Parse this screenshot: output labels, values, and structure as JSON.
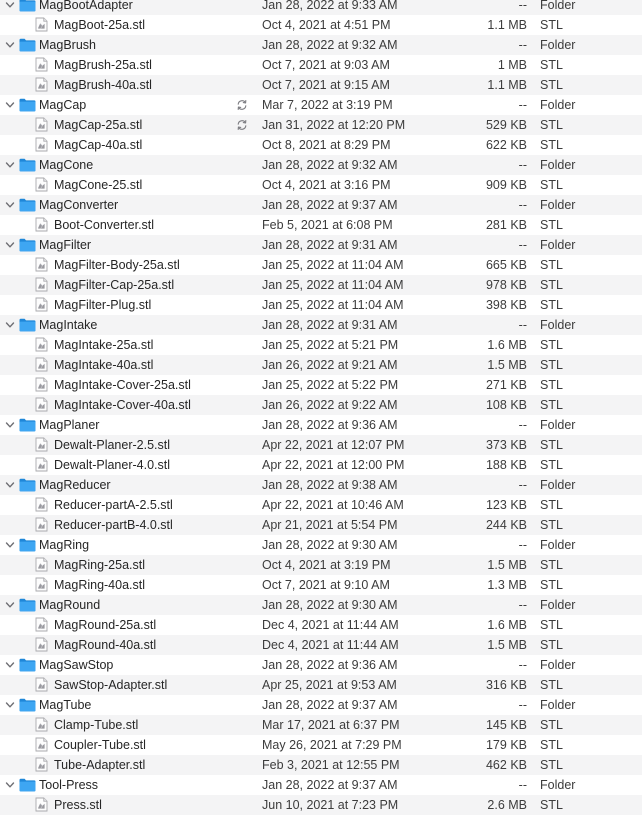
{
  "colors": {
    "folder_blue": "#3ea6f2",
    "folder_blue_dark": "#1f87d8",
    "stripe": "#f4f4f5",
    "text": "#262626",
    "secondary_text": "#3c3c3c"
  },
  "icons": {
    "disclosure": "chevron-down-icon",
    "folder": "folder-icon",
    "file": "stl-file-icon",
    "sync": "sync-icon"
  },
  "rows": [
    {
      "type": "folder",
      "name": "MagBootAdapter",
      "date": "Jan 28, 2022 at 9:33 AM",
      "size": "--",
      "kind": "Folder"
    },
    {
      "type": "file",
      "name": "MagBoot-25a.stl",
      "date": "Oct 4, 2021 at 4:51 PM",
      "size": "1.1 MB",
      "kind": "STL"
    },
    {
      "type": "folder",
      "name": "MagBrush",
      "date": "Jan 28, 2022 at 9:32 AM",
      "size": "--",
      "kind": "Folder"
    },
    {
      "type": "file",
      "name": "MagBrush-25a.stl",
      "date": "Oct 7, 2021 at 9:03 AM",
      "size": "1 MB",
      "kind": "STL"
    },
    {
      "type": "file",
      "name": "MagBrush-40a.stl",
      "date": "Oct 7, 2021 at 9:15 AM",
      "size": "1.1 MB",
      "kind": "STL"
    },
    {
      "type": "folder",
      "name": "MagCap",
      "date": "Mar 7, 2022 at 3:19 PM",
      "size": "--",
      "kind": "Folder",
      "sync": true
    },
    {
      "type": "file",
      "name": "MagCap-25a.stl",
      "date": "Jan 31, 2022 at 12:20 PM",
      "size": "529 KB",
      "kind": "STL",
      "sync": true
    },
    {
      "type": "file",
      "name": "MagCap-40a.stl",
      "date": "Oct 8, 2021 at 8:29 PM",
      "size": "622 KB",
      "kind": "STL"
    },
    {
      "type": "folder",
      "name": "MagCone",
      "date": "Jan 28, 2022 at 9:32 AM",
      "size": "--",
      "kind": "Folder"
    },
    {
      "type": "file",
      "name": "MagCone-25.stl",
      "date": "Oct 4, 2021 at 3:16 PM",
      "size": "909 KB",
      "kind": "STL"
    },
    {
      "type": "folder",
      "name": "MagConverter",
      "date": "Jan 28, 2022 at 9:37 AM",
      "size": "--",
      "kind": "Folder"
    },
    {
      "type": "file",
      "name": "Boot-Converter.stl",
      "date": "Feb 5, 2021 at 6:08 PM",
      "size": "281 KB",
      "kind": "STL"
    },
    {
      "type": "folder",
      "name": "MagFilter",
      "date": "Jan 28, 2022 at 9:31 AM",
      "size": "--",
      "kind": "Folder"
    },
    {
      "type": "file",
      "name": "MagFilter-Body-25a.stl",
      "date": "Jan 25, 2022 at 11:04 AM",
      "size": "665 KB",
      "kind": "STL"
    },
    {
      "type": "file",
      "name": "MagFilter-Cap-25a.stl",
      "date": "Jan 25, 2022 at 11:04 AM",
      "size": "978 KB",
      "kind": "STL"
    },
    {
      "type": "file",
      "name": "MagFilter-Plug.stl",
      "date": "Jan 25, 2022 at 11:04 AM",
      "size": "398 KB",
      "kind": "STL"
    },
    {
      "type": "folder",
      "name": "MagIntake",
      "date": "Jan 28, 2022 at 9:31 AM",
      "size": "--",
      "kind": "Folder"
    },
    {
      "type": "file",
      "name": "MagIntake-25a.stl",
      "date": "Jan 25, 2022 at 5:21 PM",
      "size": "1.6 MB",
      "kind": "STL"
    },
    {
      "type": "file",
      "name": "MagIntake-40a.stl",
      "date": "Jan 26, 2022 at 9:21 AM",
      "size": "1.5 MB",
      "kind": "STL"
    },
    {
      "type": "file",
      "name": "MagIntake-Cover-25a.stl",
      "date": "Jan 25, 2022 at 5:22 PM",
      "size": "271 KB",
      "kind": "STL"
    },
    {
      "type": "file",
      "name": "MagIntake-Cover-40a.stl",
      "date": "Jan 26, 2022 at 9:22 AM",
      "size": "108 KB",
      "kind": "STL"
    },
    {
      "type": "folder",
      "name": "MagPlaner",
      "date": "Jan 28, 2022 at 9:36 AM",
      "size": "--",
      "kind": "Folder"
    },
    {
      "type": "file",
      "name": "Dewalt-Planer-2.5.stl",
      "date": "Apr 22, 2021 at 12:07 PM",
      "size": "373 KB",
      "kind": "STL"
    },
    {
      "type": "file",
      "name": "Dewalt-Planer-4.0.stl",
      "date": "Apr 22, 2021 at 12:00 PM",
      "size": "188 KB",
      "kind": "STL"
    },
    {
      "type": "folder",
      "name": "MagReducer",
      "date": "Jan 28, 2022 at 9:38 AM",
      "size": "--",
      "kind": "Folder"
    },
    {
      "type": "file",
      "name": "Reducer-partA-2.5.stl",
      "date": "Apr 22, 2021 at 10:46 AM",
      "size": "123 KB",
      "kind": "STL"
    },
    {
      "type": "file",
      "name": "Reducer-partB-4.0.stl",
      "date": "Apr 21, 2021 at 5:54 PM",
      "size": "244 KB",
      "kind": "STL"
    },
    {
      "type": "folder",
      "name": "MagRing",
      "date": "Jan 28, 2022 at 9:30 AM",
      "size": "--",
      "kind": "Folder"
    },
    {
      "type": "file",
      "name": "MagRing-25a.stl",
      "date": "Oct 4, 2021 at 3:19 PM",
      "size": "1.5 MB",
      "kind": "STL"
    },
    {
      "type": "file",
      "name": "MagRing-40a.stl",
      "date": "Oct 7, 2021 at 9:10 AM",
      "size": "1.3 MB",
      "kind": "STL"
    },
    {
      "type": "folder",
      "name": "MagRound",
      "date": "Jan 28, 2022 at 9:30 AM",
      "size": "--",
      "kind": "Folder"
    },
    {
      "type": "file",
      "name": "MagRound-25a.stl",
      "date": "Dec 4, 2021 at 11:44 AM",
      "size": "1.6 MB",
      "kind": "STL"
    },
    {
      "type": "file",
      "name": "MagRound-40a.stl",
      "date": "Dec 4, 2021 at 11:44 AM",
      "size": "1.5 MB",
      "kind": "STL"
    },
    {
      "type": "folder",
      "name": "MagSawStop",
      "date": "Jan 28, 2022 at 9:36 AM",
      "size": "--",
      "kind": "Folder"
    },
    {
      "type": "file",
      "name": "SawStop-Adapter.stl",
      "date": "Apr 25, 2021 at 9:53 AM",
      "size": "316 KB",
      "kind": "STL"
    },
    {
      "type": "folder",
      "name": "MagTube",
      "date": "Jan 28, 2022 at 9:37 AM",
      "size": "--",
      "kind": "Folder"
    },
    {
      "type": "file",
      "name": "Clamp-Tube.stl",
      "date": "Mar 17, 2021 at 6:37 PM",
      "size": "145 KB",
      "kind": "STL"
    },
    {
      "type": "file",
      "name": "Coupler-Tube.stl",
      "date": "May 26, 2021 at 7:29 PM",
      "size": "179 KB",
      "kind": "STL"
    },
    {
      "type": "file",
      "name": "Tube-Adapter.stl",
      "date": "Feb 3, 2021 at 12:55 PM",
      "size": "462 KB",
      "kind": "STL"
    },
    {
      "type": "folder",
      "name": "Tool-Press",
      "date": "Jan 28, 2022 at 9:37 AM",
      "size": "--",
      "kind": "Folder"
    },
    {
      "type": "file",
      "name": "Press.stl",
      "date": "Jun 10, 2021 at 7:23 PM",
      "size": "2.6 MB",
      "kind": "STL"
    }
  ]
}
